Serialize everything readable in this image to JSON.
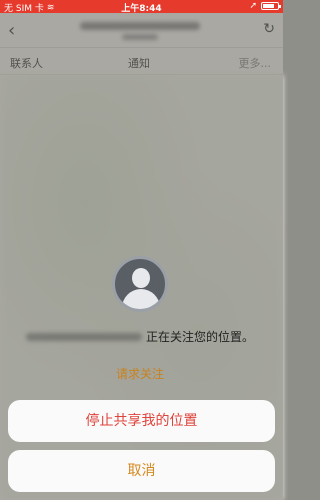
{
  "status_bar": {
    "carrier": "无 SIM 卡",
    "time": "上午8:44",
    "battery_level": 0.8
  },
  "nav": {
    "back_icon": "chevron-left-icon",
    "refresh_icon": "refresh-icon"
  },
  "tabs": [
    {
      "label": "联系人"
    },
    {
      "label": "通知"
    },
    {
      "label": "更多..."
    }
  ],
  "panel": {
    "following_text": "正在关注您的位置。",
    "request_follow": "请求关注"
  },
  "action_sheet": {
    "stop_sharing": "停止共享我的位置",
    "cancel": "取消"
  },
  "colors": {
    "status_bar_bg": "#e63a2c",
    "destructive": "#e0433b",
    "accent": "#d4891c"
  }
}
